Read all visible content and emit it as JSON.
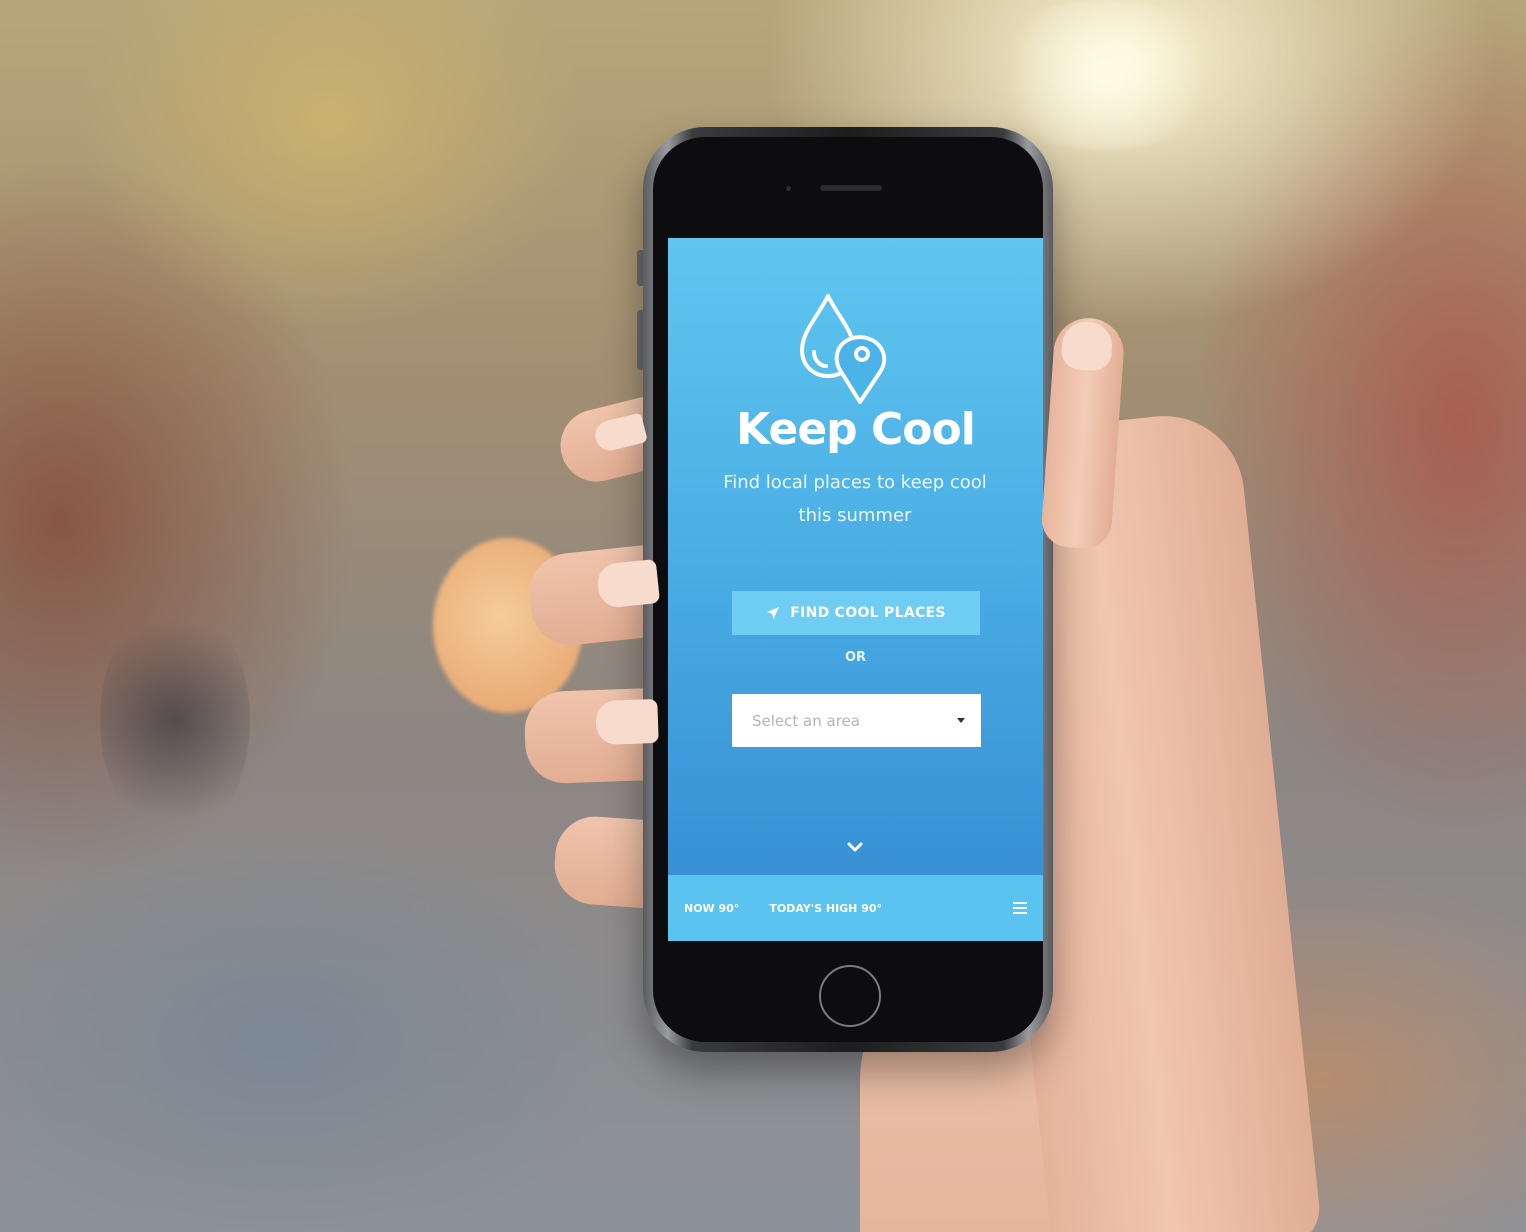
{
  "app": {
    "title": "Keep Cool",
    "subtitle": "Find local places to keep cool this summer"
  },
  "actions": {
    "find_label": "FIND COOL PLACES",
    "find_icon": "location-arrow-icon",
    "or_label": "OR"
  },
  "area_select": {
    "placeholder": "Select an area"
  },
  "weather": {
    "now": "NOW 90°",
    "today_high": "TODAY'S HIGH 90°"
  },
  "icons": {
    "logo": "water-drop-location-pin-logo",
    "scroll": "chevron-down-icon",
    "menu": "hamburger-menu-icon"
  },
  "colors": {
    "screen_top": "#5fc6f0",
    "screen_bottom": "#3a8fd3",
    "button": "#6fcdf3",
    "bottom_bar": "#5bc3ef"
  }
}
